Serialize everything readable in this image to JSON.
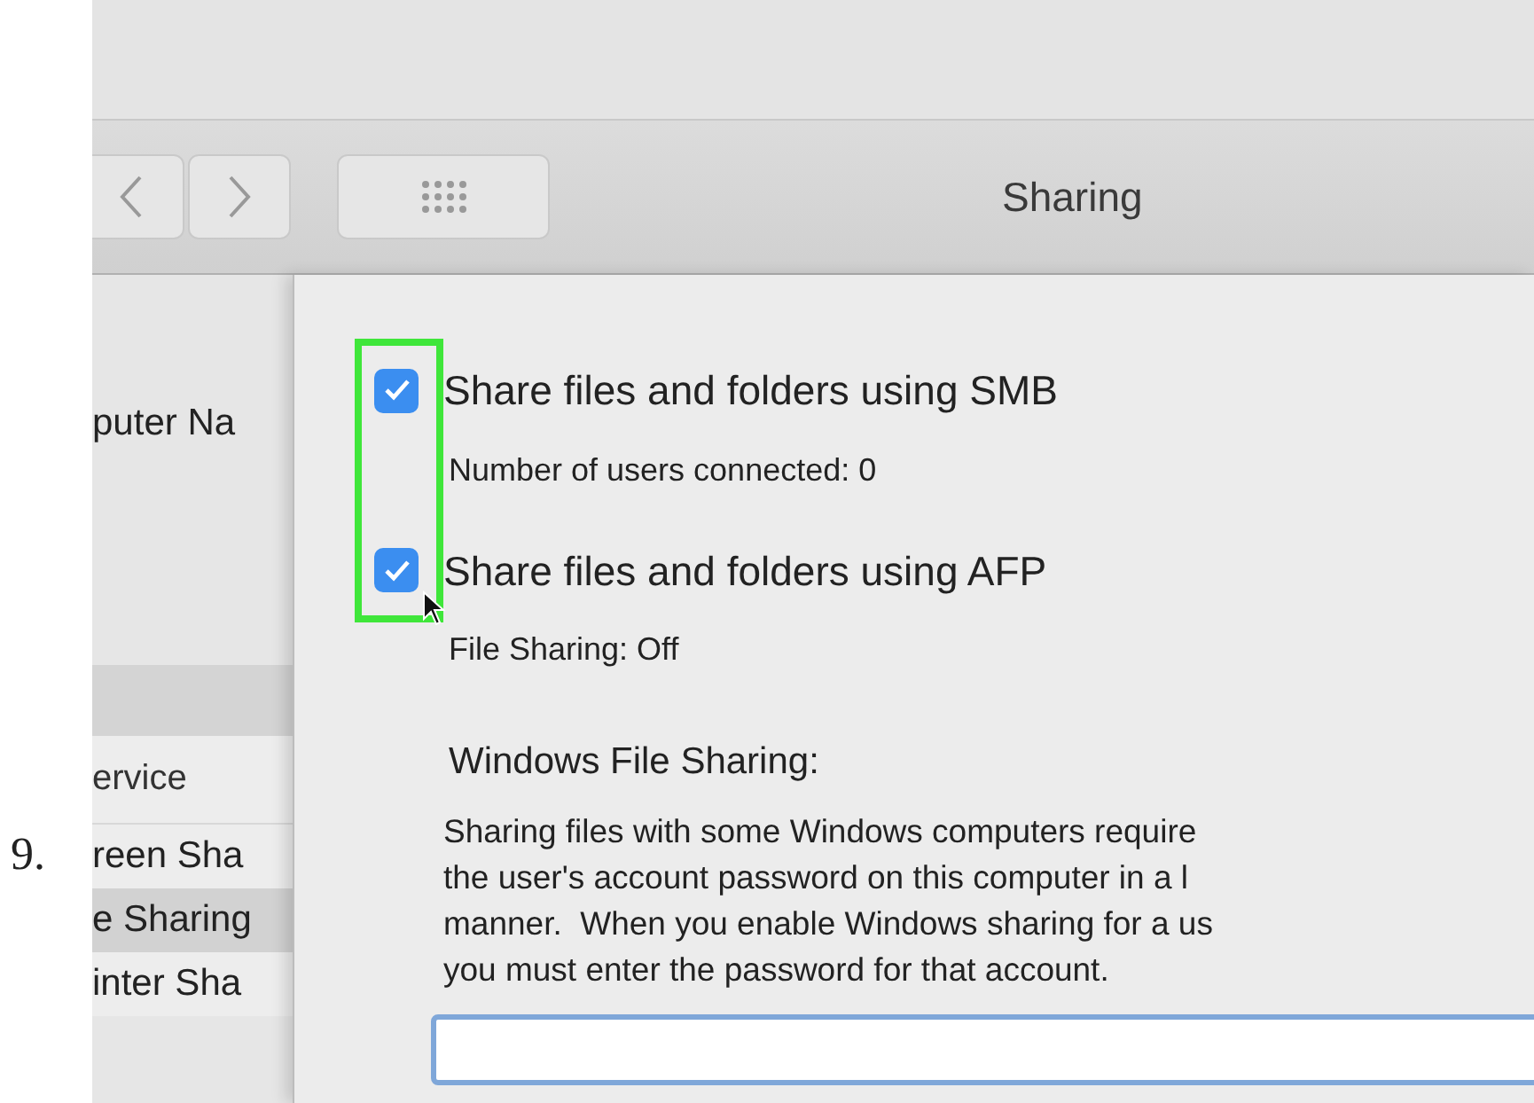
{
  "step_number": "9.",
  "window": {
    "title": "Sharing"
  },
  "sidebar": {
    "computer_name_label": "puter Na",
    "service_list": {
      "header": "ervice",
      "items": [
        {
          "label": "reen Sha",
          "selected": false
        },
        {
          "label": "e Sharing",
          "selected": true
        },
        {
          "label": "inter Sha",
          "selected": false
        }
      ]
    }
  },
  "options": [
    {
      "label": "Share files and folders using SMB",
      "checked": true,
      "status": "Number of users connected: 0"
    },
    {
      "label": "Share files and folders using AFP",
      "checked": true,
      "status": "File Sharing: Off"
    }
  ],
  "windows_sharing": {
    "heading": "Windows File Sharing:",
    "lines": [
      "Sharing files with some Windows computers require",
      "the user's account password on this computer in a l",
      "manner.  When you enable Windows sharing for a us",
      "you must enter the password for that account."
    ]
  }
}
